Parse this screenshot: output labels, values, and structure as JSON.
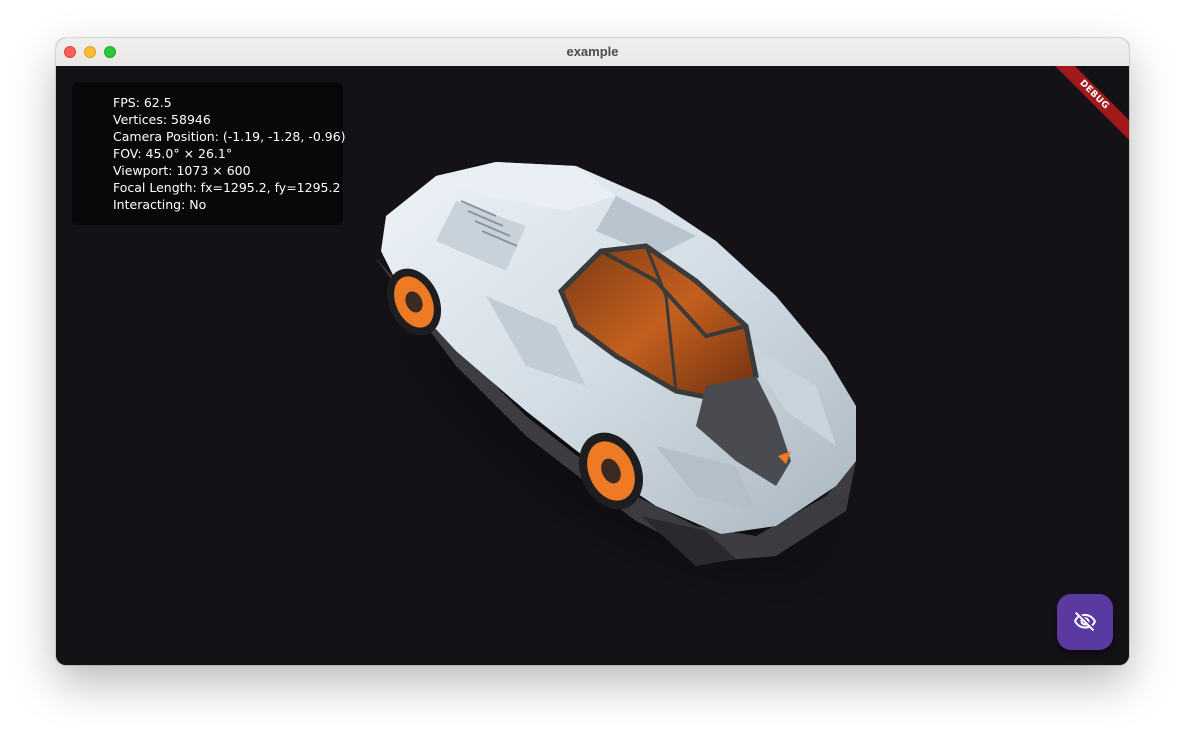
{
  "window": {
    "title": "example"
  },
  "debug": {
    "banner_label": "DEBUG"
  },
  "stats": {
    "fps": "FPS: 62.5",
    "vertices": "Vertices: 58946",
    "camera_position": "Camera Position: (-1.19, -1.28, -0.96)",
    "fov": "FOV: 45.0° × 26.1°",
    "viewport": "Viewport: 1073 × 600",
    "focal_length": "Focal Length: fx=1295.2, fy=1295.2",
    "interacting": "Interacting: No"
  },
  "fab": {
    "icon": "visibility-off-icon"
  },
  "colors": {
    "viewport_background": "#141117",
    "fab_background": "#5a3aa0",
    "debug_banner": "#a1191a",
    "car_body": "#d5e0e8",
    "car_accent": "#f07a24"
  }
}
